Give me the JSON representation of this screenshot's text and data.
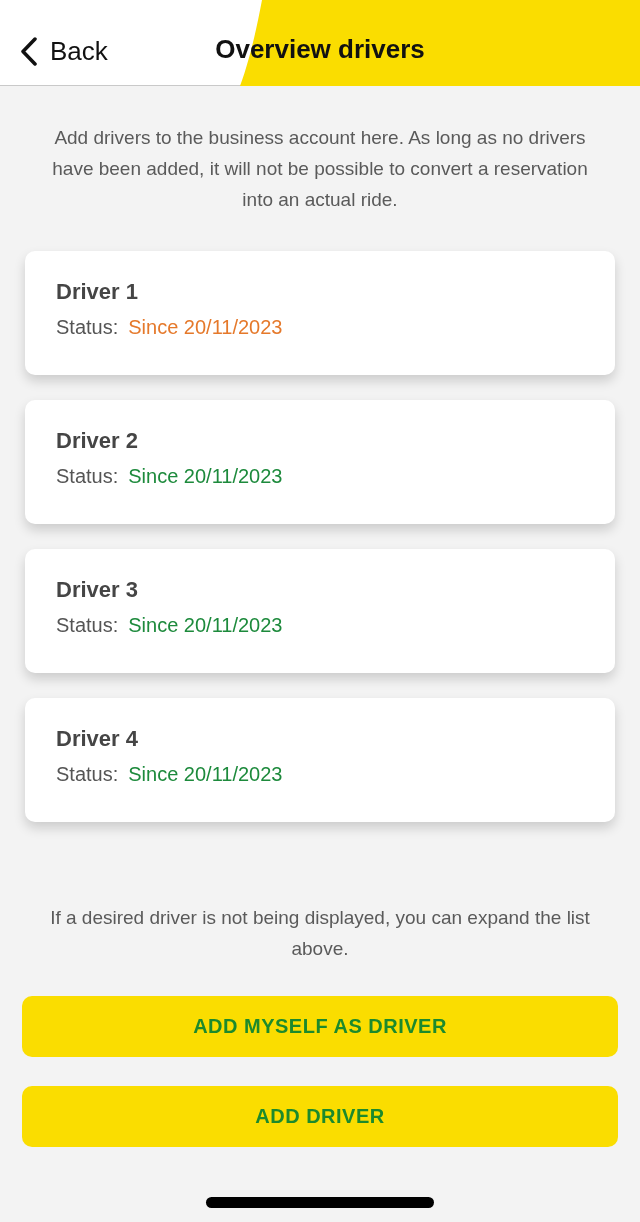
{
  "header": {
    "back_label": "Back",
    "title": "Overview drivers"
  },
  "intro": "Add drivers to the business account here. As long as no drivers have been added, it will not be possible to convert a reservation into an actual ride.",
  "drivers": [
    {
      "name": "Driver 1",
      "status_label": "Status:",
      "status": "Since 20/11/2023",
      "color": "#e5792b"
    },
    {
      "name": "Driver 2",
      "status_label": "Status:",
      "status": "Since 20/11/2023",
      "color": "#1d8a3c"
    },
    {
      "name": "Driver 3",
      "status_label": "Status:",
      "status": "Since 20/11/2023",
      "color": "#1d8a3c"
    },
    {
      "name": "Driver 4",
      "status_label": "Status:",
      "status": "Since 20/11/2023",
      "color": "#1d8a3c"
    }
  ],
  "hint": "If a desired driver is not being displayed, you can expand the list above.",
  "buttons": [
    {
      "label": "ADD MYSELF AS DRIVER"
    },
    {
      "label": "ADD DRIVER"
    }
  ]
}
